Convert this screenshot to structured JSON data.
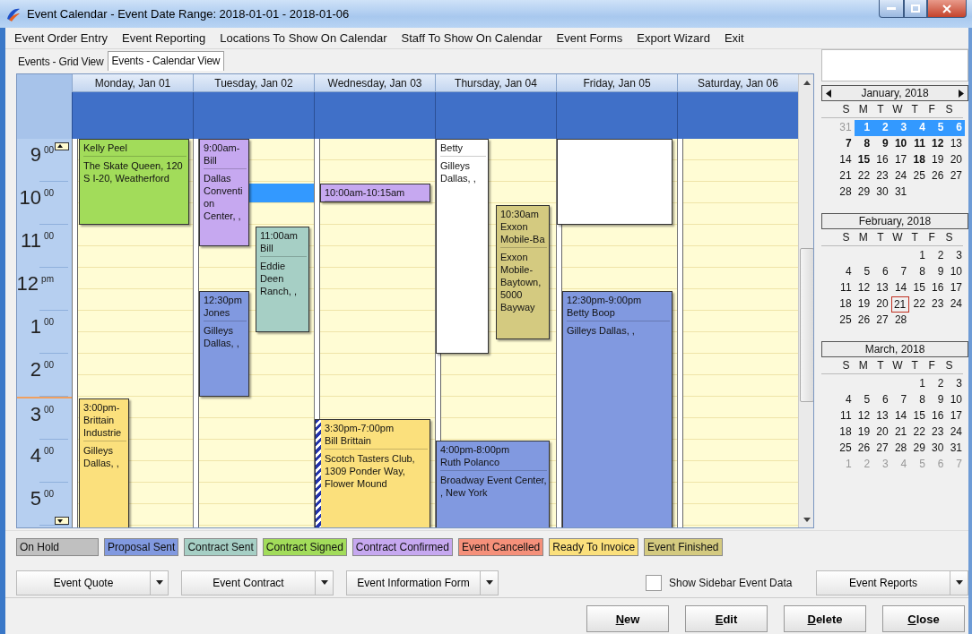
{
  "window": {
    "title": "Event Calendar - Event Date Range: 2018-01-01 - 2018-01-06"
  },
  "menu": [
    "Event Order Entry",
    "Event Reporting",
    "Locations To Show On Calendar",
    "Staff To Show On Calendar",
    "Event Forms",
    "Export Wizard",
    "Exit"
  ],
  "tabs": [
    {
      "label": "Events - Grid View",
      "selected": false
    },
    {
      "label": "Events - Calendar View",
      "selected": true
    }
  ],
  "hours": [
    {
      "hour": "9",
      "suffix": "00",
      "current": false
    },
    {
      "hour": "10",
      "suffix": "00",
      "current": false
    },
    {
      "hour": "11",
      "suffix": "00",
      "current": false
    },
    {
      "hour": "12",
      "suffix": "pm",
      "current": false
    },
    {
      "hour": "1",
      "suffix": "00",
      "current": false
    },
    {
      "hour": "2",
      "suffix": "00",
      "current": false
    },
    {
      "hour": "3",
      "suffix": "00",
      "current": true
    },
    {
      "hour": "4",
      "suffix": "00",
      "current": false
    },
    {
      "hour": "5",
      "suffix": "00",
      "current": false
    }
  ],
  "days": [
    {
      "label": "Monday, Jan 01",
      "events": [
        {
          "name": "Kelly Peel",
          "location": "The Skate Queen, 120 S I-20, Weatherford",
          "color": "#a2dc5a",
          "hatched": false
        },
        {
          "time": "3:00pm-",
          "name": "Brittain Industrie",
          "location": "Gilleys Dallas, ,",
          "color": "#fbe07c",
          "hatched": false
        }
      ]
    },
    {
      "label": "Tuesday, Jan 02",
      "selection": true,
      "events": [
        {
          "time": "9:00am-",
          "name": "Bill",
          "location": "Dallas Convention Center, ,",
          "color": "#c6a8f0",
          "hatched": false
        },
        {
          "time": "11:00am",
          "name": "Bill",
          "location": "Eddie Deen Ranch, ,",
          "color": "#a6cfc5",
          "hatched": false
        },
        {
          "time": "12:30pm",
          "name": "Jones",
          "location": "Gilleys Dallas, ,",
          "color": "#8199e0",
          "hatched": false
        }
      ]
    },
    {
      "label": "Wednesday, Jan 03",
      "events": [
        {
          "time": "10:00am-10:15am",
          "color": "#c6a8f0",
          "hatched": false
        },
        {
          "time": "3:30pm-7:00pm",
          "name": "Bill Brittain",
          "location": "Scotch Tasters Club, 1309 Ponder Way, Flower Mound",
          "color": "#fbe07c",
          "hatched": true
        }
      ]
    },
    {
      "label": "Thursday, Jan 04",
      "events": [
        {
          "name": "Betty",
          "location": "Gilleys Dallas, ,",
          "color": "#ffffff",
          "hatched": false
        },
        {
          "time": "10:30am",
          "name": "Exxon Mobile-Ba",
          "location": "Exxon Mobile-Baytown, 5000 Bayway",
          "color": "#d4ca80",
          "hatched": false
        },
        {
          "time": "4:00pm-8:00pm",
          "name": "Ruth Polanco",
          "location": "Broadway Event Center, , New York",
          "color": "#8199e0",
          "hatched": false
        }
      ]
    },
    {
      "label": "Friday, Jan 05",
      "events": [
        {
          "color": "#ffffff",
          "hatched": false
        },
        {
          "time": "12:30pm-9:00pm",
          "name": "Betty Boop",
          "location": "Gilleys Dallas, ,",
          "color": "#8199e0",
          "hatched": false
        }
      ]
    },
    {
      "label": "Saturday, Jan 06"
    }
  ],
  "months": [
    {
      "title": "January, 2018",
      "arrows": true,
      "weekdays": [
        "S",
        "M",
        "T",
        "W",
        "T",
        "F",
        "S"
      ],
      "weeks": [
        [
          {
            "d": "31",
            "kind": "muted",
            "selected": false
          },
          {
            "d": "1",
            "kind": "bold",
            "selected": true
          },
          {
            "d": "2",
            "kind": "bold",
            "selected": true
          },
          {
            "d": "3",
            "kind": "bold",
            "selected": true
          },
          {
            "d": "4",
            "kind": "bold",
            "selected": true
          },
          {
            "d": "5",
            "kind": "bold",
            "selected": true
          },
          {
            "d": "6",
            "kind": "bold",
            "selected": true
          }
        ],
        [
          {
            "d": "7",
            "kind": "bold",
            "selected": false
          },
          {
            "d": "8",
            "kind": "bold",
            "selected": false
          },
          {
            "d": "9",
            "kind": "bold",
            "selected": false
          },
          {
            "d": "10",
            "kind": "bold",
            "selected": false
          },
          {
            "d": "11",
            "kind": "bold",
            "selected": false
          },
          {
            "d": "12",
            "kind": "bold",
            "selected": false
          },
          {
            "d": "13",
            "kind": "normal",
            "selected": false
          }
        ],
        [
          {
            "d": "14",
            "kind": "normal",
            "selected": false
          },
          {
            "d": "15",
            "kind": "bold",
            "selected": false
          },
          {
            "d": "16",
            "kind": "normal",
            "selected": false
          },
          {
            "d": "17",
            "kind": "normal",
            "selected": false
          },
          {
            "d": "18",
            "kind": "bold",
            "selected": false
          },
          {
            "d": "19",
            "kind": "normal",
            "selected": false
          },
          {
            "d": "20",
            "kind": "normal",
            "selected": false
          }
        ],
        [
          {
            "d": "21",
            "kind": "normal",
            "selected": false
          },
          {
            "d": "22",
            "kind": "normal",
            "selected": false
          },
          {
            "d": "23",
            "kind": "normal",
            "selected": false
          },
          {
            "d": "24",
            "kind": "normal",
            "selected": false
          },
          {
            "d": "25",
            "kind": "normal",
            "selected": false
          },
          {
            "d": "26",
            "kind": "normal",
            "selected": false
          },
          {
            "d": "27",
            "kind": "normal",
            "selected": false
          }
        ],
        [
          {
            "d": "28",
            "kind": "normal",
            "selected": false
          },
          {
            "d": "29",
            "kind": "normal",
            "selected": false
          },
          {
            "d": "30",
            "kind": "normal",
            "selected": false
          },
          {
            "d": "31",
            "kind": "normal",
            "selected": false
          }
        ]
      ]
    },
    {
      "title": "February, 2018",
      "arrows": false,
      "weekdays": [
        "S",
        "M",
        "T",
        "W",
        "T",
        "F",
        "S"
      ],
      "weeks": [
        [
          {
            "d": "1",
            "kind": "normal",
            "selected": false
          },
          {
            "d": "2",
            "kind": "normal",
            "selected": false
          },
          {
            "d": "3",
            "kind": "normal",
            "selected": false
          }
        ],
        [
          {
            "d": "4",
            "kind": "normal",
            "selected": false
          },
          {
            "d": "5",
            "kind": "normal",
            "selected": false
          },
          {
            "d": "6",
            "kind": "normal",
            "selected": false
          },
          {
            "d": "7",
            "kind": "normal",
            "selected": false
          },
          {
            "d": "8",
            "kind": "normal",
            "selected": false
          },
          {
            "d": "9",
            "kind": "normal",
            "selected": false
          },
          {
            "d": "10",
            "kind": "normal",
            "selected": false
          }
        ],
        [
          {
            "d": "11",
            "kind": "normal",
            "selected": false
          },
          {
            "d": "12",
            "kind": "normal",
            "selected": false
          },
          {
            "d": "13",
            "kind": "normal",
            "selected": false
          },
          {
            "d": "14",
            "kind": "normal",
            "selected": false
          },
          {
            "d": "15",
            "kind": "normal",
            "selected": false
          },
          {
            "d": "16",
            "kind": "normal",
            "selected": false
          },
          {
            "d": "17",
            "kind": "normal",
            "selected": false
          }
        ],
        [
          {
            "d": "18",
            "kind": "normal",
            "selected": false
          },
          {
            "d": "19",
            "kind": "normal",
            "selected": false
          },
          {
            "d": "20",
            "kind": "normal",
            "selected": false
          },
          {
            "d": "21",
            "kind": "today",
            "selected": false
          },
          {
            "d": "22",
            "kind": "normal",
            "selected": false
          },
          {
            "d": "23",
            "kind": "normal",
            "selected": false
          },
          {
            "d": "24",
            "kind": "normal",
            "selected": false
          }
        ],
        [
          {
            "d": "25",
            "kind": "normal",
            "selected": false
          },
          {
            "d": "26",
            "kind": "normal",
            "selected": false
          },
          {
            "d": "27",
            "kind": "normal",
            "selected": false
          },
          {
            "d": "28",
            "kind": "normal",
            "selected": false
          }
        ]
      ]
    },
    {
      "title": "March, 2018",
      "arrows": false,
      "weekdays": [
        "S",
        "M",
        "T",
        "W",
        "T",
        "F",
        "S"
      ],
      "weeks": [
        [
          {
            "d": "1",
            "kind": "normal",
            "selected": false
          },
          {
            "d": "2",
            "kind": "normal",
            "selected": false
          },
          {
            "d": "3",
            "kind": "normal",
            "selected": false
          }
        ],
        [
          {
            "d": "4",
            "kind": "normal",
            "selected": false
          },
          {
            "d": "5",
            "kind": "normal",
            "selected": false
          },
          {
            "d": "6",
            "kind": "normal",
            "selected": false
          },
          {
            "d": "7",
            "kind": "normal",
            "selected": false
          },
          {
            "d": "8",
            "kind": "normal",
            "selected": false
          },
          {
            "d": "9",
            "kind": "normal",
            "selected": false
          },
          {
            "d": "10",
            "kind": "normal",
            "selected": false
          }
        ],
        [
          {
            "d": "11",
            "kind": "normal",
            "selected": false
          },
          {
            "d": "12",
            "kind": "normal",
            "selected": false
          },
          {
            "d": "13",
            "kind": "normal",
            "selected": false
          },
          {
            "d": "14",
            "kind": "normal",
            "selected": false
          },
          {
            "d": "15",
            "kind": "normal",
            "selected": false
          },
          {
            "d": "16",
            "kind": "normal",
            "selected": false
          },
          {
            "d": "17",
            "kind": "normal",
            "selected": false
          }
        ],
        [
          {
            "d": "18",
            "kind": "normal",
            "selected": false
          },
          {
            "d": "19",
            "kind": "normal",
            "selected": false
          },
          {
            "d": "20",
            "kind": "normal",
            "selected": false
          },
          {
            "d": "21",
            "kind": "normal",
            "selected": false
          },
          {
            "d": "22",
            "kind": "normal",
            "selected": false
          },
          {
            "d": "23",
            "kind": "normal",
            "selected": false
          },
          {
            "d": "24",
            "kind": "normal",
            "selected": false
          }
        ],
        [
          {
            "d": "25",
            "kind": "normal",
            "selected": false
          },
          {
            "d": "26",
            "kind": "normal",
            "selected": false
          },
          {
            "d": "27",
            "kind": "normal",
            "selected": false
          },
          {
            "d": "28",
            "kind": "normal",
            "selected": false
          },
          {
            "d": "29",
            "kind": "normal",
            "selected": false
          },
          {
            "d": "30",
            "kind": "normal",
            "selected": false
          },
          {
            "d": "31",
            "kind": "normal",
            "selected": false
          }
        ],
        [
          {
            "d": "1",
            "kind": "muted",
            "selected": false
          },
          {
            "d": "2",
            "kind": "muted",
            "selected": false
          },
          {
            "d": "3",
            "kind": "muted",
            "selected": false
          },
          {
            "d": "4",
            "kind": "muted",
            "selected": false
          },
          {
            "d": "5",
            "kind": "muted",
            "selected": false
          },
          {
            "d": "6",
            "kind": "muted",
            "selected": false
          },
          {
            "d": "7",
            "kind": "muted",
            "selected": false
          }
        ]
      ]
    }
  ],
  "legend": [
    {
      "label": "On Hold",
      "color": "#c0c0c0"
    },
    {
      "label": "Proposal Sent",
      "color": "#8199e0"
    },
    {
      "label": "Contract Sent",
      "color": "#a6cfc5"
    },
    {
      "label": "Contract Signed",
      "color": "#a2dc5a"
    },
    {
      "label": "Contract Confirmed",
      "color": "#c6a8f0"
    },
    {
      "label": "Event Cancelled",
      "color": "#f5907a"
    },
    {
      "label": "Ready To Invoice",
      "color": "#fbe07c"
    },
    {
      "label": "Event Finished",
      "color": "#d4ca80"
    }
  ],
  "form_buttons": [
    "Event Quote",
    "Event Contract",
    "Event Information Form"
  ],
  "sidebar_checkbox": {
    "label": "Show Sidebar Event Data",
    "checked": false
  },
  "reports_button": "Event Reports",
  "actions": [
    "New",
    "Edit",
    "Delete",
    "Close"
  ]
}
